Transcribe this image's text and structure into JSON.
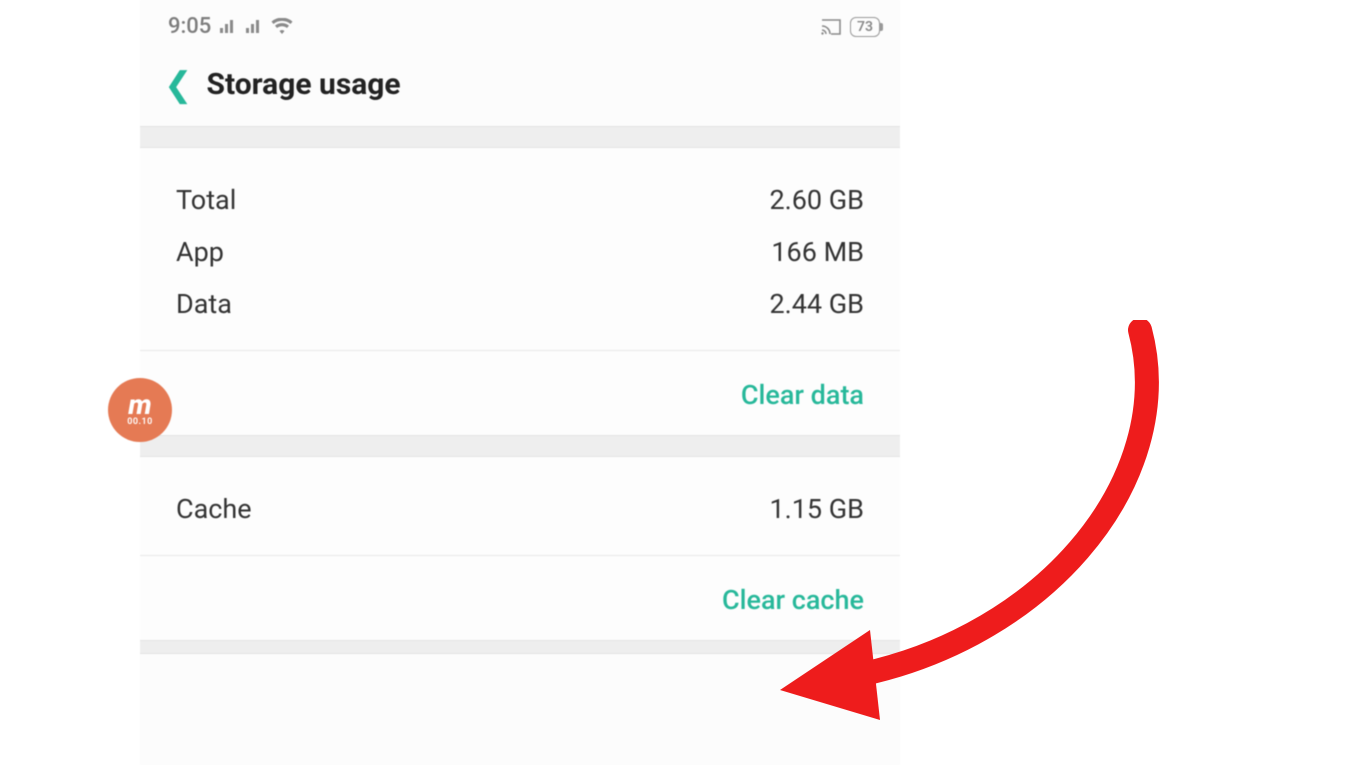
{
  "status_bar": {
    "time": "9:05",
    "battery_percent": "73"
  },
  "header": {
    "title": "Storage usage"
  },
  "storage": {
    "rows": [
      {
        "label": "Total",
        "value": "2.60 GB"
      },
      {
        "label": "App",
        "value": "166 MB"
      },
      {
        "label": "Data",
        "value": "2.44 GB"
      }
    ],
    "clear_data_label": "Clear data"
  },
  "cache": {
    "label": "Cache",
    "value": "1.15 GB",
    "clear_cache_label": "Clear cache"
  },
  "overlay_badge": {
    "text": "m",
    "sub": "00.10"
  },
  "colors": {
    "accent": "#27b89a",
    "annotation": "#ee1c1c",
    "badge": "#e57a54"
  }
}
